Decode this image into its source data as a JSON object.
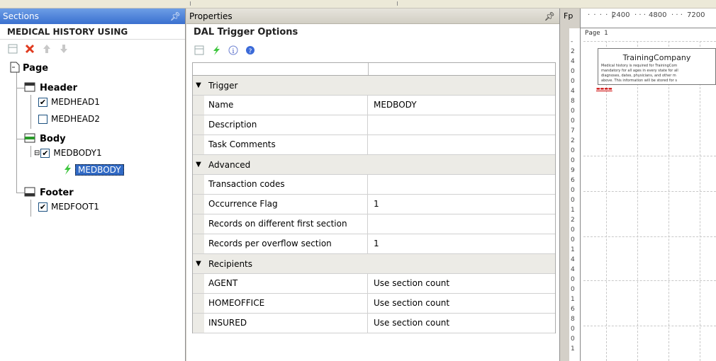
{
  "sections": {
    "header_label": "Sections",
    "title": "MEDICAL HISTORY USING",
    "toolbar": [
      "new-icon",
      "delete-icon",
      "move-up-icon",
      "move-down-icon"
    ],
    "tree": {
      "page": "Page",
      "header": {
        "label": "Header",
        "items": [
          {
            "label": "MEDHEAD1",
            "checked": true
          },
          {
            "label": "MEDHEAD2",
            "checked": false
          }
        ]
      },
      "body": {
        "label": "Body",
        "item": {
          "label": "MEDBODY1",
          "checked": true
        },
        "trigger": "MEDBODY"
      },
      "footer": {
        "label": "Footer",
        "items": [
          {
            "label": "MEDFOOT1",
            "checked": true
          }
        ]
      }
    },
    "pin": "ᵖ"
  },
  "properties": {
    "header_label": "Properties",
    "title": "DAL Trigger Options",
    "toolbar": [
      "new-icon",
      "lightning-icon",
      "info-icon",
      "help-icon"
    ],
    "categories": [
      {
        "label": "Trigger",
        "rows": [
          {
            "key": "Name",
            "value": "MEDBODY"
          },
          {
            "key": "Description",
            "value": ""
          },
          {
            "key": "Task Comments",
            "value": ""
          }
        ]
      },
      {
        "label": "Advanced",
        "rows": [
          {
            "key": "Transaction codes",
            "value": ""
          },
          {
            "key": "Occurrence Flag",
            "value": "1"
          },
          {
            "key": "Records on different first section",
            "value": ""
          },
          {
            "key": "Records per overflow section",
            "value": "1"
          }
        ]
      },
      {
        "label": "Recipients",
        "rows": [
          {
            "key": "AGENT",
            "value": "Use section count"
          },
          {
            "key": "HOMEOFFICE",
            "value": "Use section count"
          },
          {
            "key": "INSURED",
            "value": "Use section count"
          }
        ]
      }
    ]
  },
  "preview": {
    "fp_label": "Fp",
    "ruler_labels": [
      "2400",
      "4800",
      "7200"
    ],
    "page_label": "Page 1",
    "doc_title": "TrainingCompany",
    "doc_lines": [
      "Medical history is required for TrainingCom",
      "mandatory for all ages in every state for all",
      "diagnoses, dates, physicians, and other m",
      "above. This information will be stored for s"
    ]
  }
}
